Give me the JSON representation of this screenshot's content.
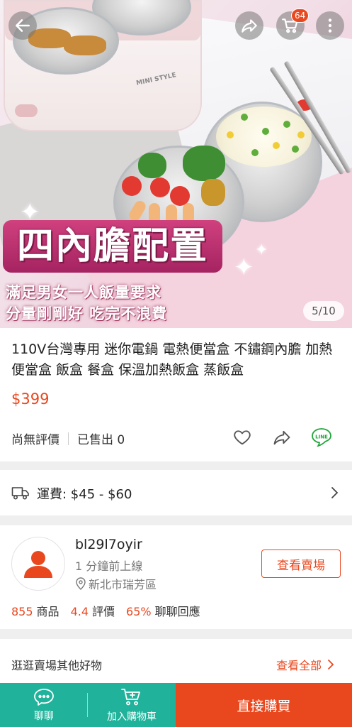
{
  "header": {
    "cart_count": "64",
    "image_counter": "5/10"
  },
  "hero": {
    "banner_text": "四內膽配置",
    "subtitle_1": "滿足男女一人飯量要求",
    "subtitle_2": "分量剛剛好 吃完不浪費",
    "brand_mark": "MINI STYLE"
  },
  "product": {
    "title": "110V台灣專用 迷你電鍋 電熱便當盒 不鏽鋼內膽 加熱便當盒 飯盒 餐盒 保溫加熱飯盒 蒸飯盒",
    "price": "$399",
    "rating_text": "尚無評價",
    "sold_text": "已售出 0",
    "line_label": "LINE"
  },
  "shipping": {
    "label": "運費: $45 - $60"
  },
  "seller": {
    "name": "bl29l7oyir",
    "online": "1 分鐘前上線",
    "location": "新北市瑞芳區",
    "visit_label": "查看賣場",
    "stats": [
      {
        "num": "855",
        "label": "商品"
      },
      {
        "num": "4.4",
        "label": "評價"
      },
      {
        "num": "65%",
        "label": "聊聊回應"
      }
    ]
  },
  "more": {
    "label": "逛逛賣場其他好物",
    "all_label": "查看全部"
  },
  "bottom_bar": {
    "chat_label": "聊聊",
    "add_cart_label": "加入購物車",
    "buy_label": "直接購買"
  },
  "colors": {
    "accent": "#e9481f",
    "teal": "#20b29a"
  }
}
